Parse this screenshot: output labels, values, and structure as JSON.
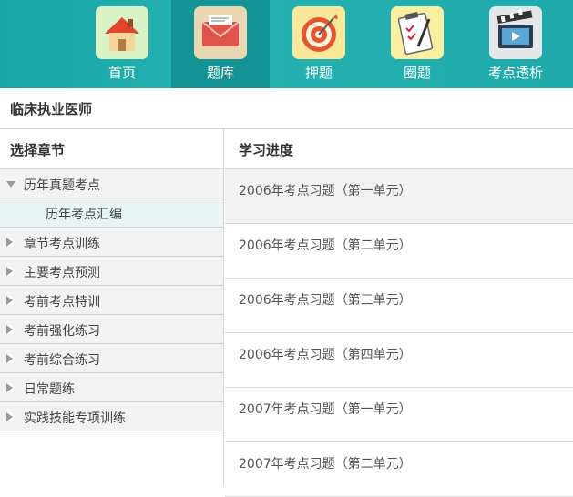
{
  "nav": {
    "items": [
      {
        "label": "首页",
        "icon": "house-icon",
        "active": false
      },
      {
        "label": "题库",
        "icon": "envelope-icon",
        "active": true
      },
      {
        "label": "押题",
        "icon": "target-icon",
        "active": false
      },
      {
        "label": "圈题",
        "icon": "clipboard-icon",
        "active": false
      },
      {
        "label": "考点透析",
        "icon": "film-icon",
        "active": false
      }
    ],
    "colors": {
      "bar": "#1fa9aa",
      "active": "#139393"
    }
  },
  "subbar": {
    "title": "临床执业医师"
  },
  "left": {
    "heading": "选择章节",
    "chapters": [
      {
        "label": "历年真题考点",
        "expanded": true,
        "children": [
          {
            "label": "历年考点汇编"
          }
        ]
      },
      {
        "label": "章节考点训练",
        "expanded": false
      },
      {
        "label": "主要考点预测",
        "expanded": false
      },
      {
        "label": "考前考点特训",
        "expanded": false
      },
      {
        "label": "考前强化练习",
        "expanded": false
      },
      {
        "label": "考前综合练习",
        "expanded": false
      },
      {
        "label": "日常题练",
        "expanded": false
      },
      {
        "label": "实践技能专项训练",
        "expanded": false
      }
    ]
  },
  "right": {
    "heading": "学习进度",
    "items": [
      {
        "label": "2006年考点习题（第一单元）"
      },
      {
        "label": "2006年考点习题（第二单元）"
      },
      {
        "label": "2006年考点习题（第三单元）"
      },
      {
        "label": "2006年考点习题（第四单元）"
      },
      {
        "label": "2007年考点习题（第一单元）"
      },
      {
        "label": "2007年考点习题（第二单元）"
      }
    ]
  }
}
